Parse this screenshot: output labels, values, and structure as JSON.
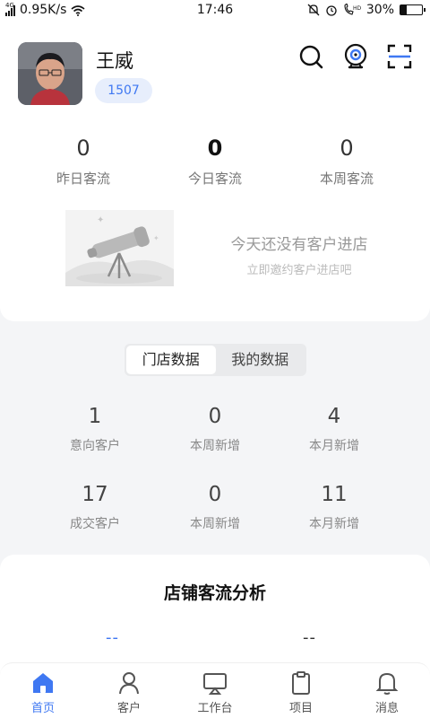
{
  "status_bar": {
    "network_type": "4G",
    "speed": "0.95K/s",
    "time": "17:46",
    "battery": "30%",
    "battery_level": 0.3
  },
  "profile": {
    "name": "王威",
    "badge": "1507"
  },
  "traffic": [
    {
      "value": "0",
      "label": "昨日客流"
    },
    {
      "value": "0",
      "label": "今日客流"
    },
    {
      "value": "0",
      "label": "本周客流"
    }
  ],
  "empty_state": {
    "title": "今天还没有客户进店",
    "subtitle": "立即邀约客户进店吧"
  },
  "segment": {
    "tabs": [
      "门店数据",
      "我的数据"
    ],
    "active": 0
  },
  "customer_stats": [
    {
      "value": "1",
      "label": "意向客户"
    },
    {
      "value": "0",
      "label": "本周新增"
    },
    {
      "value": "4",
      "label": "本月新增"
    },
    {
      "value": "17",
      "label": "成交客户"
    },
    {
      "value": "0",
      "label": "本周新增"
    },
    {
      "value": "11",
      "label": "本月新增"
    }
  ],
  "analysis": {
    "title": "店铺客流分析",
    "left_value": "--",
    "right_value": "--"
  },
  "tabbar": [
    {
      "label": "首页",
      "icon": "home-icon",
      "active": true
    },
    {
      "label": "客户",
      "icon": "person-icon",
      "active": false
    },
    {
      "label": "工作台",
      "icon": "screen-icon",
      "active": false
    },
    {
      "label": "项目",
      "icon": "clipboard-icon",
      "active": false
    },
    {
      "label": "消息",
      "icon": "bell-icon",
      "active": false
    }
  ],
  "colors": {
    "accent": "#3f78f2",
    "badge_bg": "#e7eefc"
  }
}
